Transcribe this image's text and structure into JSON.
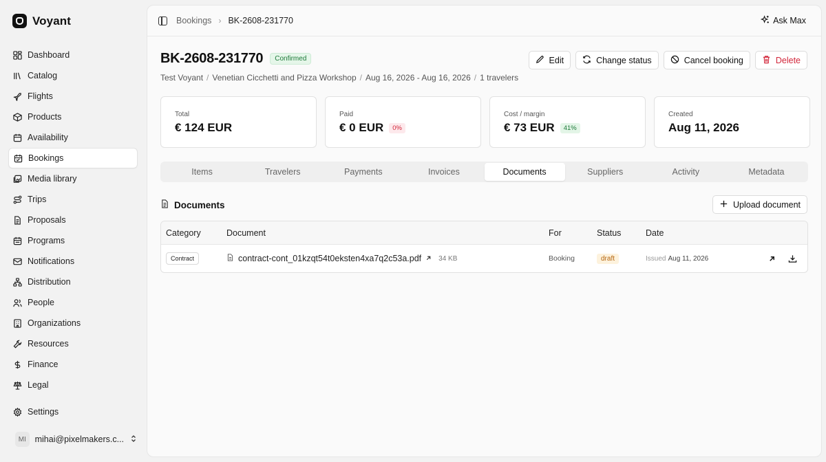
{
  "app": {
    "name": "Voyant"
  },
  "sidebar": {
    "items": [
      {
        "label": "Dashboard",
        "icon": "dashboard-icon"
      },
      {
        "label": "Catalog",
        "icon": "catalog-icon"
      },
      {
        "label": "Flights",
        "icon": "plane-icon"
      },
      {
        "label": "Products",
        "icon": "package-icon"
      },
      {
        "label": "Availability",
        "icon": "calendar-icon"
      },
      {
        "label": "Bookings",
        "icon": "calendar-check-icon",
        "active": true
      },
      {
        "label": "Media library",
        "icon": "images-icon"
      },
      {
        "label": "Trips",
        "icon": "route-icon"
      },
      {
        "label": "Proposals",
        "icon": "file-icon"
      },
      {
        "label": "Programs",
        "icon": "calendar-range-icon"
      },
      {
        "label": "Notifications",
        "icon": "mail-icon"
      },
      {
        "label": "Distribution",
        "icon": "network-icon"
      },
      {
        "label": "People",
        "icon": "users-icon"
      },
      {
        "label": "Organizations",
        "icon": "building-icon"
      },
      {
        "label": "Resources",
        "icon": "wrench-icon"
      },
      {
        "label": "Finance",
        "icon": "dollar-icon"
      },
      {
        "label": "Legal",
        "icon": "scale-icon"
      }
    ],
    "settings_label": "Settings",
    "user": {
      "initials": "MI",
      "email": "mihai@pixelmakers.c..."
    }
  },
  "topbar": {
    "breadcrumb_parent": "Bookings",
    "breadcrumb_current": "BK-2608-231770",
    "ask_label": "Ask Max"
  },
  "booking": {
    "id": "BK-2608-231770",
    "status_badge": "Confirmed",
    "customer": "Test Voyant",
    "product": "Venetian Cicchetti and Pizza Workshop",
    "dates": "Aug 16, 2026 - Aug 16, 2026",
    "travelers": "1 travelers"
  },
  "actions": {
    "edit": "Edit",
    "change_status": "Change status",
    "cancel": "Cancel booking",
    "delete": "Delete"
  },
  "stats": {
    "total_label": "Total",
    "total_value": "€ 124 EUR",
    "paid_label": "Paid",
    "paid_value": "€ 0 EUR",
    "paid_pill": "0%",
    "cost_label": "Cost / margin",
    "cost_value": "€ 73 EUR",
    "cost_pill": "41%",
    "created_label": "Created",
    "created_value": "Aug 11, 2026"
  },
  "tabs": [
    "Items",
    "Travelers",
    "Payments",
    "Invoices",
    "Documents",
    "Suppliers",
    "Activity",
    "Metadata"
  ],
  "active_tab": "Documents",
  "documents": {
    "title": "Documents",
    "upload_label": "Upload document",
    "columns": {
      "category": "Category",
      "document": "Document",
      "for": "For",
      "status": "Status",
      "date": "Date"
    },
    "rows": [
      {
        "category": "Contract",
        "name": "contract-cont_01kzqt54t0eksten4xa7q2c53a.pdf",
        "size": "34 KB",
        "for": "Booking",
        "status": "draft",
        "date_prefix": "Issued",
        "date": "Aug 11, 2026"
      }
    ]
  },
  "colors": {
    "danger": "#d2263a",
    "success": "#1e7a3a",
    "warning": "#b5650f"
  }
}
